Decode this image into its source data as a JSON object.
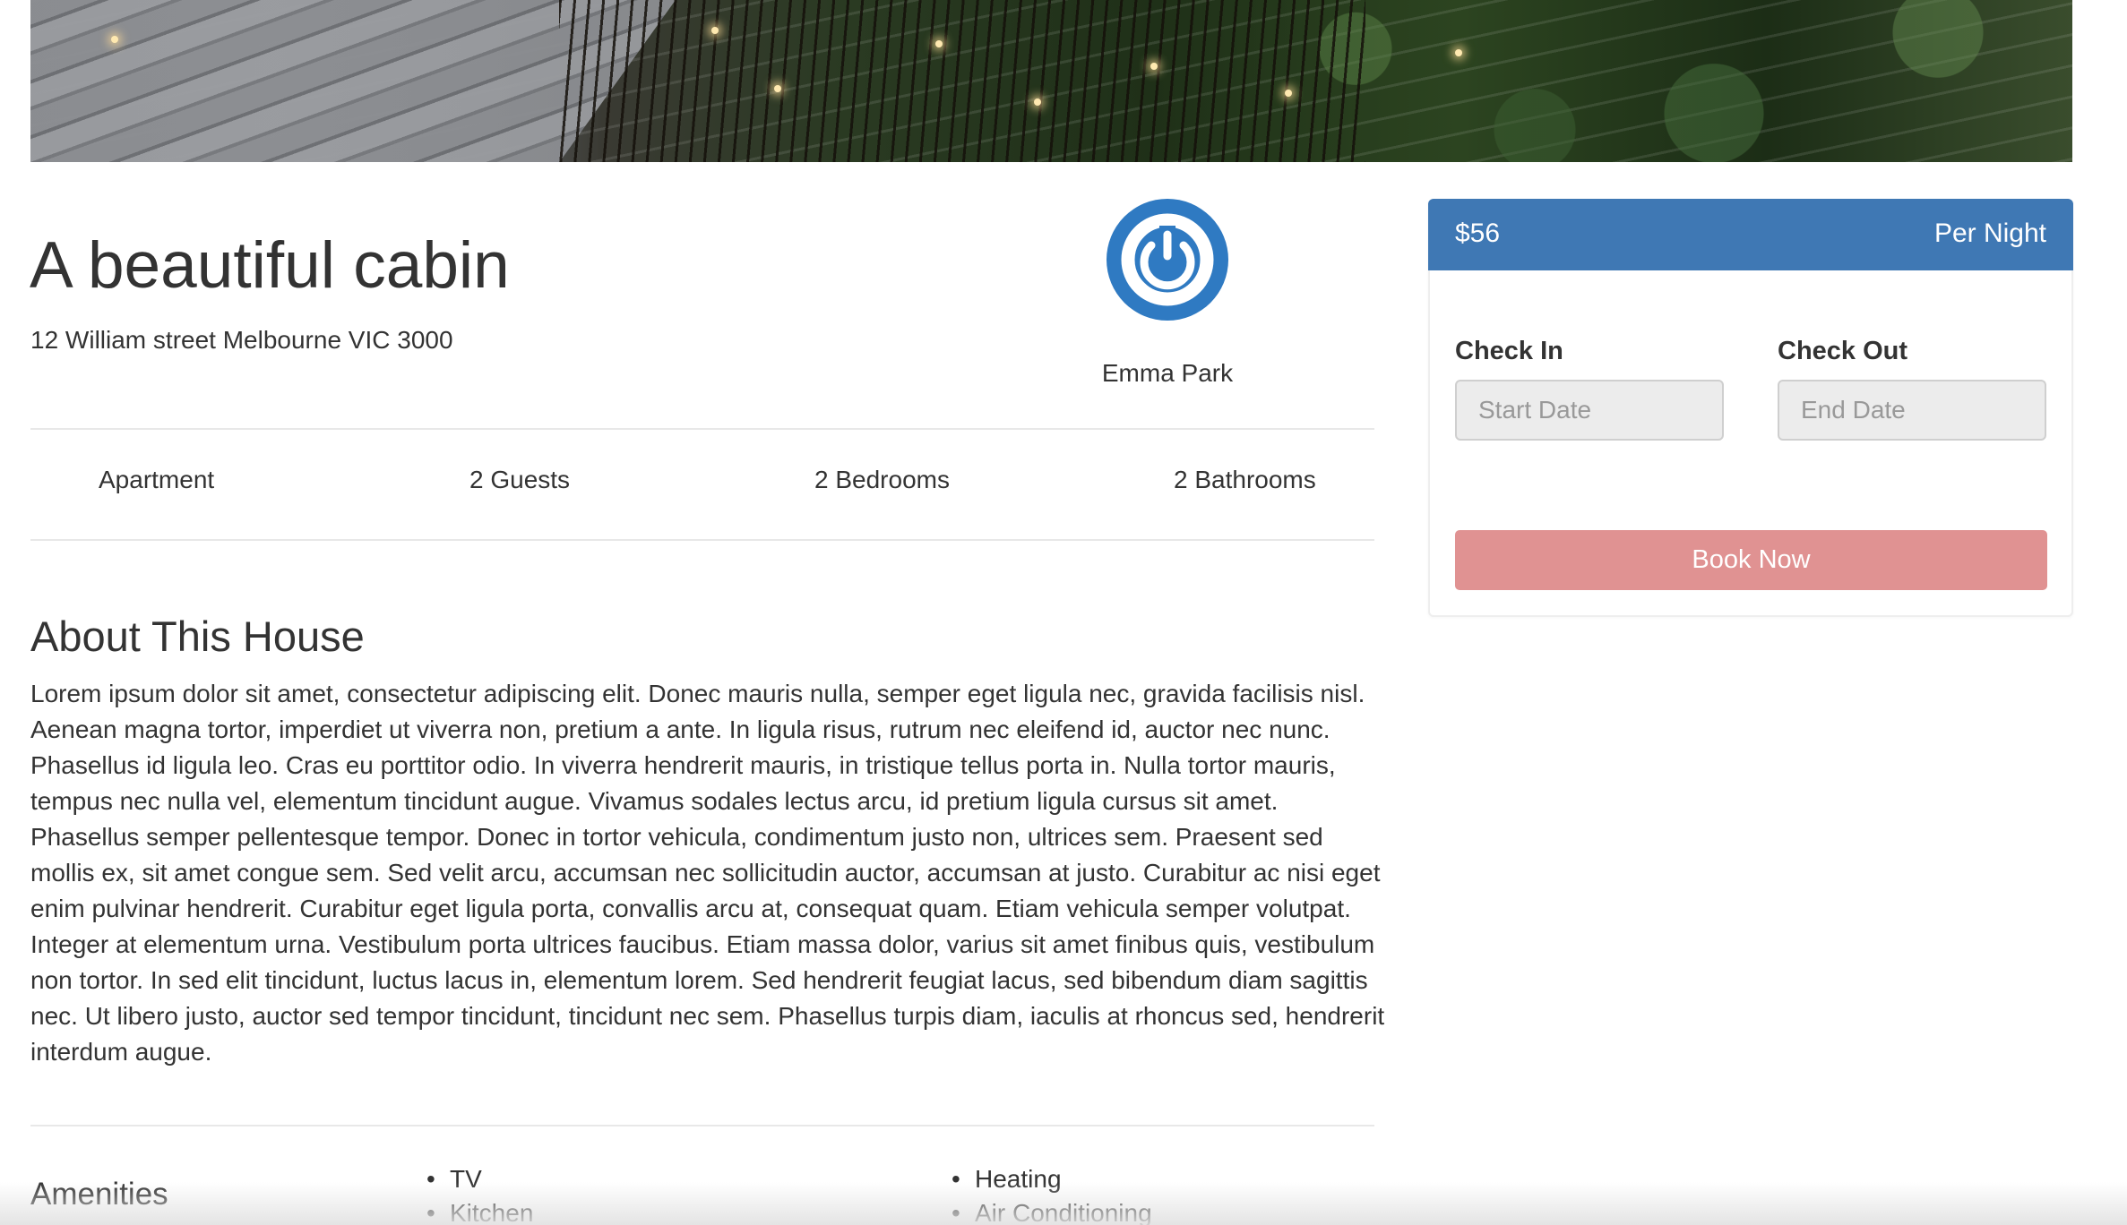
{
  "listing": {
    "title": "A beautiful cabin",
    "address": "12 William street Melbourne VIC 3000"
  },
  "host": {
    "name": "Emma Park",
    "avatar_icon": "power-icon",
    "avatar_color": "#2f7ac2"
  },
  "stats": {
    "type": "Apartment",
    "guests": "2 Guests",
    "bedrooms": "2 Bedrooms",
    "bathrooms": "2 Bathrooms"
  },
  "about": {
    "title": "About This House",
    "body": "Lorem ipsum dolor sit amet, consectetur adipiscing elit. Donec mauris nulla, semper eget ligula nec, gravida facilisis nisl. Aenean magna tortor, imperdiet ut viverra non, pretium a ante. In ligula risus, rutrum nec eleifend id, auctor nec nunc. Phasellus id ligula leo. Cras eu porttitor odio. In viverra hendrerit mauris, in tristique tellus porta in. Nulla tortor mauris, tempus nec nulla vel, elementum tincidunt augue. Vivamus sodales lectus arcu, id pretium ligula cursus sit amet. Phasellus semper pellentesque tempor. Donec in tortor vehicula, condimentum justo non, ultrices sem. Praesent sed mollis ex, sit amet congue sem. Sed velit arcu, accumsan nec sollicitudin auctor, accumsan at justo. Curabitur ac nisi eget enim pulvinar hendrerit. Curabitur eget ligula porta, convallis arcu at, consequat quam. Etiam vehicula semper volutpat. Integer at elementum urna. Vestibulum porta ultrices faucibus. Etiam massa dolor, varius sit amet finibus quis, vestibulum non tortor. In sed elit tincidunt, luctus lacus in, elementum lorem. Sed hendrerit feugiat lacus, sed bibendum diam sagittis nec. Ut libero justo, auctor sed tempor tincidunt, tincidunt nec sem. Phasellus turpis diam, iaculis at rhoncus sed, hendrerit interdum augue."
  },
  "amenities": {
    "title": "Amenities",
    "column1": [
      "TV",
      "Kitchen"
    ],
    "column2": [
      "Heating",
      "Air Conditioning"
    ]
  },
  "booking": {
    "price": "$56",
    "per": "Per Night",
    "check_in_label": "Check In",
    "check_out_label": "Check Out",
    "start_placeholder": "Start Date",
    "end_placeholder": "End Date",
    "book_label": "Book Now",
    "header_color": "#3f78b4",
    "button_color": "#e09292"
  }
}
